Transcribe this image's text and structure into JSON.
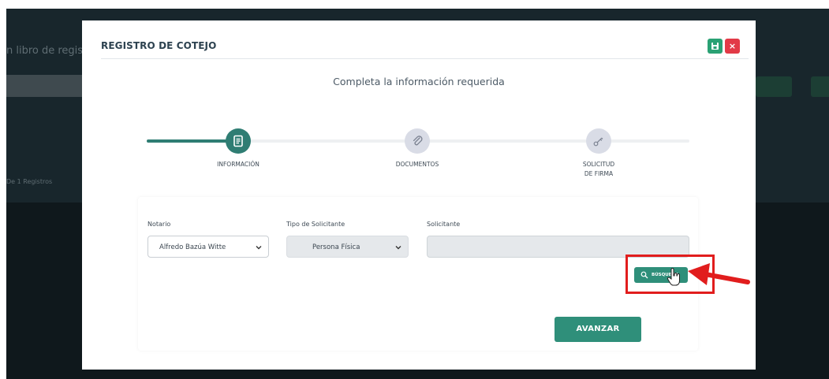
{
  "background": {
    "page_title_fragment": "n libro de regist",
    "registros_fragment": "De 1 Registros"
  },
  "modal": {
    "title": "REGISTRO DE COTEJO",
    "subtitle": "Completa la información requerida",
    "close_label": "×"
  },
  "steps": [
    {
      "label": "INFORMACIÓN",
      "icon": "document-icon",
      "state": "active"
    },
    {
      "label": "DOCUMENTOS",
      "icon": "paperclip-icon",
      "state": "pending"
    },
    {
      "label_line1": "SOLICITUD",
      "label_line2": "DE FIRMA",
      "icon": "key-icon",
      "state": "pending"
    }
  ],
  "form": {
    "notario_label": "Notario",
    "notario_value": "Alfredo Bazúa Witte",
    "tipo_label": "Tipo de Solicitante",
    "tipo_value": "Persona Física",
    "solicitante_label": "Solicitante",
    "solicitante_value": "",
    "busqueda_label": "BÚSQUEDA",
    "avanzar_label": "AVANZAR"
  },
  "colors": {
    "accent": "#2f8f7a",
    "step_active": "#2f7d73",
    "close_red": "#e23a47",
    "save_green": "#2aa174",
    "annotation_red": "#e11d1d"
  }
}
